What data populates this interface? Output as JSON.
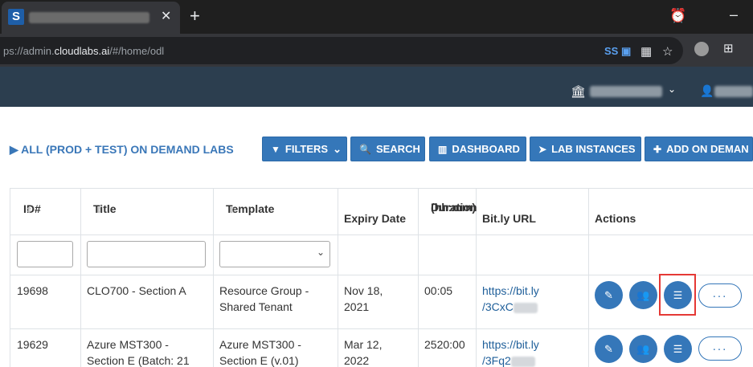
{
  "browser": {
    "favicon_letter": "S",
    "close_glyph": "✕",
    "newtab_glyph": "+",
    "url_prefix": "ps://admin.",
    "url_domain": "cloudlabs.ai",
    "url_path": "/#/home/odl",
    "extension_label": "SS"
  },
  "header": {
    "org_chevron": "⌄"
  },
  "page": {
    "title": "▶ ALL (PROD + TEST) ON DEMAND LABS"
  },
  "toolbar": {
    "filters_label": "FILTERS",
    "filters_chevron": "⌄",
    "search_label": "SEARCH",
    "dashboard_label": "DASHBOARD",
    "lab_instances_label": "LAB INSTANCES",
    "add_label": "ADD ON DEMAN"
  },
  "table": {
    "headers": {
      "id": "ID#",
      "title": "Title",
      "template": "Template",
      "expiry": "Expiry Date",
      "duration_line1": "Duration",
      "duration_line2": "(hh:mm)",
      "url": "Bit.ly URL",
      "actions": "Actions"
    },
    "rows": [
      {
        "id": "19698",
        "title_line1": "CLO700 - Section A",
        "title_line2": "",
        "template_line1": "Resource Group -",
        "template_line2": "Shared Tenant",
        "expiry_line1": "Nov 18,",
        "expiry_line2": "2021",
        "duration": "00:05",
        "url_line1": "https://bit.ly",
        "url_line2": "/3CxC"
      },
      {
        "id": "19629",
        "title_line1": "Azure MST300 -",
        "title_line2": "Section E (Batch: 21",
        "template_line1": "Azure MST300 -",
        "template_line2": "Section E (v.01)",
        "expiry_line1": "Mar 12,",
        "expiry_line2": "2022",
        "duration": "2520:00",
        "url_line1": "https://bit.ly",
        "url_line2": "/3Fq2"
      }
    ],
    "more_label": "..."
  },
  "colors": {
    "primary": "#3577b9",
    "appbar": "#2c3e4f",
    "title": "#3a77b8",
    "highlight": "#e53935"
  }
}
